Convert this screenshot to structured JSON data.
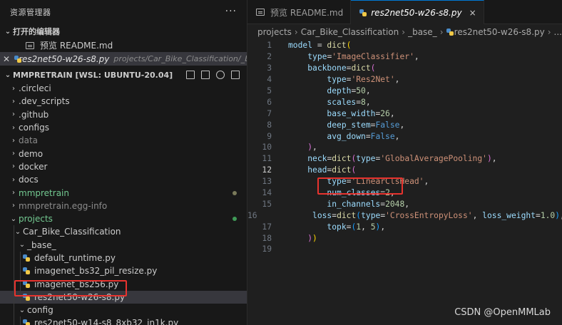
{
  "explorer": {
    "title": "资源管理器",
    "more": "···",
    "open_editors": {
      "header": "打开的编辑器",
      "items": [
        {
          "name": "预览 README.md",
          "path": ""
        },
        {
          "name": "res2net50-w26-s8.py",
          "path": "projects/Car_Bike_Classification/_base_"
        }
      ]
    },
    "workspace": {
      "header": "MMPRETRAIN [WSL: UBUNTU-20.04]",
      "items": [
        {
          "label": ".circleci"
        },
        {
          "label": ".dev_scripts"
        },
        {
          "label": ".github"
        },
        {
          "label": "configs"
        },
        {
          "label": "data"
        },
        {
          "label": "demo"
        },
        {
          "label": "docker"
        },
        {
          "label": "docs"
        },
        {
          "label": "mmpretrain"
        },
        {
          "label": "mmpretrain.egg-info"
        },
        {
          "label": "projects"
        },
        {
          "label": "Car_Bike_Classification"
        },
        {
          "label": "_base_"
        },
        {
          "label": "default_runtime.py"
        },
        {
          "label": "imagenet_bs32_pil_resize.py"
        },
        {
          "label": "imagenet_bs256.py"
        },
        {
          "label": "res2net50-w26-s8.py"
        },
        {
          "label": "config"
        },
        {
          "label": "res2net50-w14-s8_8xb32_in1k.py"
        }
      ]
    }
  },
  "tabs": [
    {
      "label": "预览 README.md",
      "close": ""
    },
    {
      "label": "res2net50-w26-s8.py",
      "close": "×"
    }
  ],
  "breadcrumb": {
    "parts": [
      "projects",
      "Car_Bike_Classification",
      "_base_",
      "res2net50-w26-s8.py",
      "..."
    ]
  },
  "code_lines": [
    "1",
    "2",
    "3",
    "4",
    "5",
    "6",
    "7",
    "8",
    "9",
    "10",
    "11",
    "12",
    "13",
    "14",
    "15",
    "16",
    "17",
    "18",
    "19"
  ],
  "code": {
    "model": "model",
    "dict": "dict",
    "type_key": "type",
    "image_classifier": "'ImageClassifier'",
    "backbone": "backbone",
    "res2net": "'Res2Net'",
    "depth": "depth",
    "depth_val": "50",
    "scales": "scales",
    "scales_val": "8",
    "base_width": "base_width",
    "base_width_val": "26",
    "deep_stem": "deep_stem",
    "deep_stem_val": "False",
    "avg_down": "avg_down",
    "avg_down_val": "False",
    "neck": "neck",
    "gap": "'GlobalAveragePooling'",
    "head": "head",
    "linear_head": "'LinearClsHead'",
    "num_classes": "num_classes",
    "num_classes_val": "2",
    "in_channels": "in_channels",
    "in_channels_val": "2048",
    "loss": "loss",
    "ce_loss": "'CrossEntropyLoss'",
    "loss_weight": "loss_weight",
    "loss_weight_val": "1.0",
    "topk": "topk",
    "topk_a": "1",
    "topk_b": "5"
  },
  "watermark": "CSDN @OpenMMLab"
}
